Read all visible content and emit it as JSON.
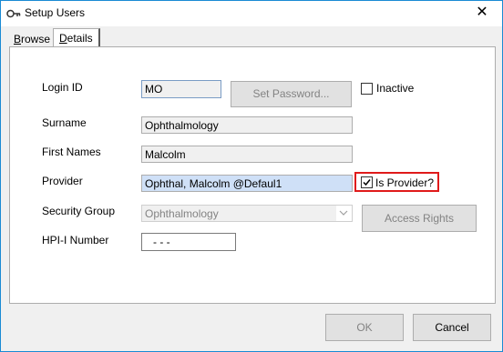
{
  "window": {
    "title": "Setup Users",
    "icon": "key-icon",
    "close": "✕"
  },
  "tabs": [
    {
      "prefix": "",
      "ul": "B",
      "rest": "rowse"
    },
    {
      "prefix": "",
      "ul": "D",
      "rest": "etails"
    }
  ],
  "form": {
    "login_id": {
      "label": "Login ID",
      "value": "MO"
    },
    "set_password_label": "Set Password...",
    "inactive_label": "Inactive",
    "surname": {
      "label": "Surname",
      "value": "Ophthalmology"
    },
    "first_names": {
      "label": "First Names",
      "value": "Malcolm"
    },
    "provider": {
      "label": "Provider",
      "value": "Ophthal, Malcolm @Defaul1"
    },
    "is_provider_label": "Is Provider?",
    "is_provider_checked": true,
    "security_group": {
      "label": "Security Group",
      "value": "Ophthalmology"
    },
    "access_rights_label": "Access Rights",
    "hpi_number": {
      "label": "HPI-I Number",
      "value": "  -  -  -"
    }
  },
  "footer": {
    "ok_label": "OK",
    "cancel_label": "Cancel"
  }
}
